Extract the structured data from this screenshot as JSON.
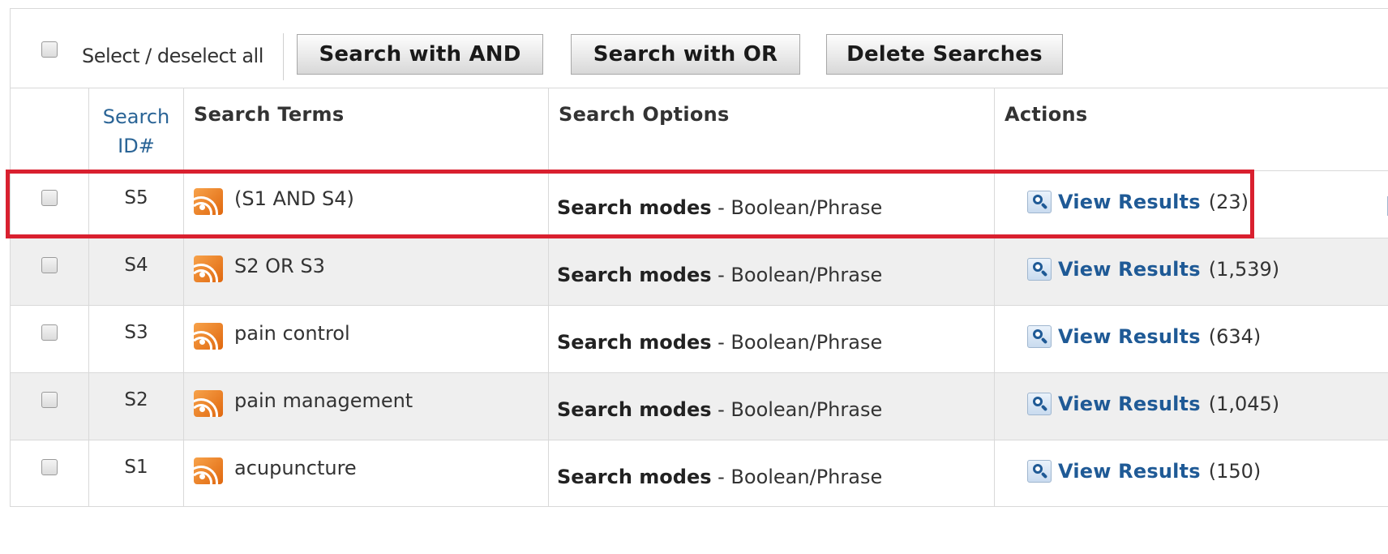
{
  "toolbar": {
    "select_all_label": "Select / deselect all",
    "search_and_label": "Search with AND",
    "search_or_label": "Search with OR",
    "delete_label": "Delete Searches"
  },
  "table": {
    "headers": {
      "id": "Search ID#",
      "terms": "Search Terms",
      "options": "Search Options",
      "actions": "Actions"
    },
    "rows": [
      {
        "id": "S5",
        "terms": "(S1 AND S4)",
        "options_bold": "Search modes",
        "options_rest": " - Boolean/Phrase",
        "action": "View Results",
        "count": "(23)"
      },
      {
        "id": "S4",
        "terms": "S2 OR S3",
        "options_bold": "Search modes",
        "options_rest": " - Boolean/Phrase",
        "action": "View Results",
        "count": "(1,539)"
      },
      {
        "id": "S3",
        "terms": "pain control",
        "options_bold": "Search modes",
        "options_rest": " - Boolean/Phrase",
        "action": "View Results",
        "count": "(634)"
      },
      {
        "id": "S2",
        "terms": "pain management",
        "options_bold": "Search modes",
        "options_rest": " - Boolean/Phrase",
        "action": "View Results",
        "count": "(1,045)"
      },
      {
        "id": "S1",
        "terms": "acupuncture",
        "options_bold": "Search modes",
        "options_rest": " - Boolean/Phrase",
        "action": "View Results",
        "count": "(150)"
      }
    ]
  },
  "icons": {
    "feed": "rss-icon",
    "view": "magnifier-icon",
    "checkbox": "checkbox-icon"
  },
  "colors": {
    "link": "#1f5a96",
    "highlight": "#d9202f",
    "rss": "#f08a24",
    "alt_row": "#efefef"
  },
  "highlighted_row_id": "S5"
}
